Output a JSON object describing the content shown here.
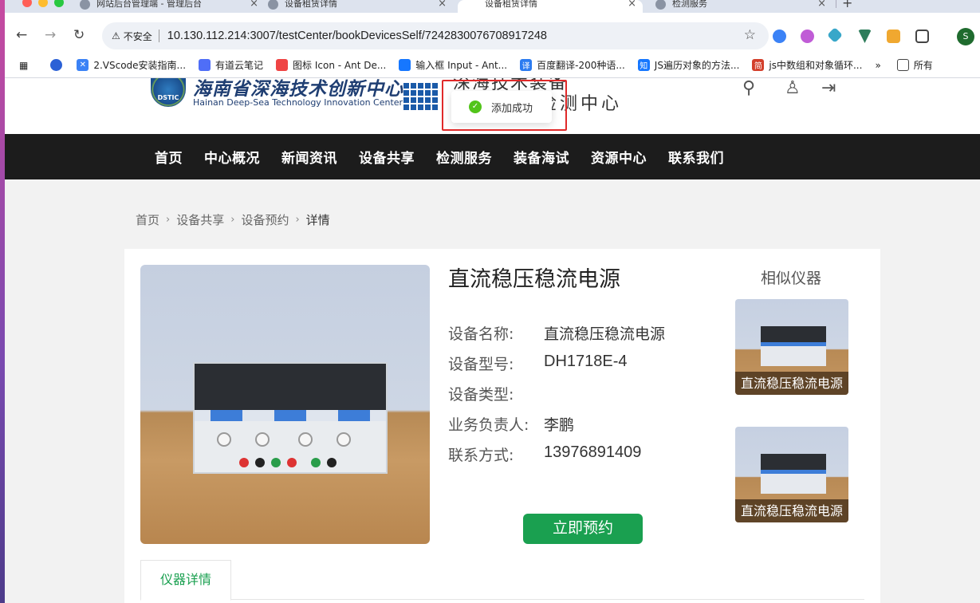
{
  "browser": {
    "tabs": [
      {
        "title": "网站后台管理端 - 管理后台"
      },
      {
        "title": "设备租赁详情"
      },
      {
        "title": "设备租赁详情"
      },
      {
        "title": "检测服务"
      }
    ],
    "url_warning": "不安全",
    "url": "10.130.112.214:3007/testCenter/bookDevicesSelf/7242830076708917248",
    "profile_initial": "S",
    "bookmarks": [
      {
        "label": "2.VScode安装指南..."
      },
      {
        "label": "有道云笔记"
      },
      {
        "label": "图标 Icon - Ant De..."
      },
      {
        "label": "输入框 Input - Ant..."
      },
      {
        "label": "百度翻译-200种语..."
      },
      {
        "label": "JS遍历对象的方法..."
      },
      {
        "label": "js中数组和对象循环..."
      },
      {
        "label": "所有"
      }
    ],
    "bookmarks_overflow": "»"
  },
  "site": {
    "logo_badge": "DSTIC",
    "logo_cn": "海南省深海技术创新中心",
    "logo_en": "Hainan Deep-Sea Technology Innovation Center",
    "center_title_top": "深海技术装备",
    "center_title": "检测中心"
  },
  "toast": {
    "message": "添加成功"
  },
  "nav": [
    "首页",
    "中心概况",
    "新闻资讯",
    "设备共享",
    "检测服务",
    "装备海试",
    "资源中心",
    "联系我们"
  ],
  "breadcrumb": {
    "items": [
      "首页",
      "设备共享",
      "设备预约"
    ],
    "current": "详情"
  },
  "device": {
    "title": "直流稳压稳流电源",
    "fields": [
      {
        "label": "设备名称:",
        "value": "直流稳压稳流电源"
      },
      {
        "label": "设备型号:",
        "value": "DH1718E-4"
      },
      {
        "label": "设备类型:",
        "value": ""
      },
      {
        "label": "业务负责人:",
        "value": "李鹏"
      },
      {
        "label": "联系方式:",
        "value": "13976891409"
      }
    ],
    "reserve_label": "立即预约"
  },
  "similar": {
    "title": "相似仪器",
    "items": [
      {
        "caption": "直流稳压稳流电源"
      },
      {
        "caption": "直流稳压稳流电源"
      }
    ]
  },
  "detail_tabs": [
    {
      "label": "仪器详情"
    }
  ]
}
